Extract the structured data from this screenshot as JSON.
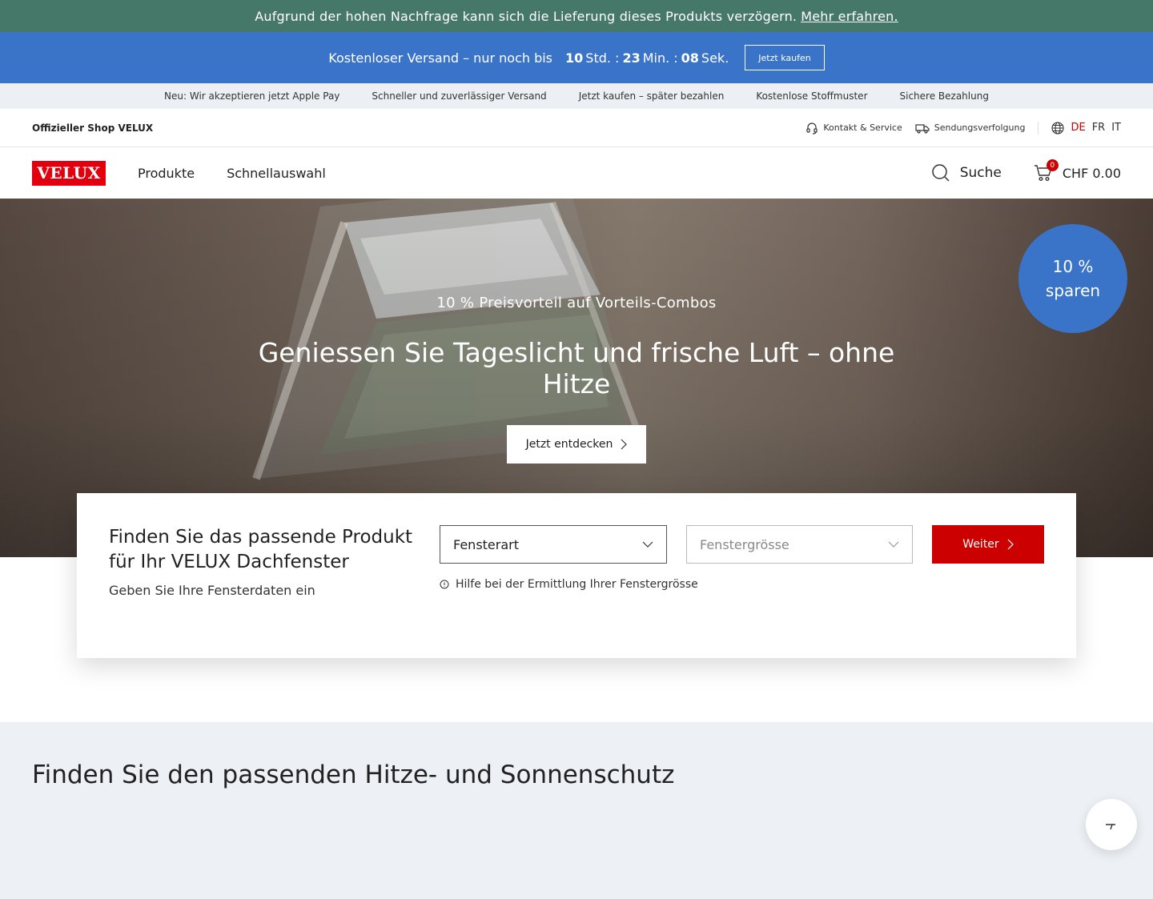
{
  "notice": {
    "text": "Aufgrund der hohen Nachfrage kann sich die Lieferung dieses Produkts verzögern.",
    "link": "Mehr erfahren."
  },
  "promo": {
    "text": "Kostenloser Versand – nur noch bis",
    "hours": "10",
    "hours_unit": "Std. :",
    "minutes": "23",
    "minutes_unit": "Min. :",
    "seconds": "08",
    "seconds_unit": "Sek.",
    "button": "Jetzt kaufen"
  },
  "usps": [
    "Neu: Wir akzeptieren jetzt Apple Pay",
    "Schneller und zuverlässiger Versand",
    "Jetzt kaufen – später bezahlen",
    "Kostenlose Stoffmuster",
    "Sichere Bezahlung"
  ],
  "utility": {
    "shop_label": "Offizieller Shop VELUX",
    "contact": "Kontakt & Service",
    "tracking": "Sendungsverfolgung",
    "languages": [
      "DE",
      "FR",
      "IT"
    ]
  },
  "nav": {
    "logo": "VELUX",
    "items": [
      "Produkte",
      "Schnellauswahl"
    ],
    "search": "Suche",
    "cart_count": "0",
    "cart_total": "CHF 0.00"
  },
  "hero": {
    "kicker": "10 % Preisvorteil auf Vorteils-Combos",
    "title": "Geniessen Sie Tageslicht und frische Luft – ohne Hitze",
    "cta": "Jetzt entdecken",
    "badge_line1": "10 %",
    "badge_line2": "sparen"
  },
  "finder": {
    "title": "Finden Sie das passende Produkt für Ihr VELUX Dachfenster",
    "subtitle": "Geben Sie Ihre Fensterdaten ein",
    "select1": "Fensterart",
    "select2": "Fenstergrösse",
    "next": "Weiter",
    "help": "Hilfe bei der Ermittlung Ihrer Fenstergrösse"
  },
  "section2": {
    "title": "Finden Sie den passenden Hitze- und Sonnenschutz"
  },
  "colors": {
    "notice_bg": "#457868",
    "promo_bg": "#3a74c9",
    "brand_red": "#e2000f",
    "button_red": "#cc0000"
  }
}
